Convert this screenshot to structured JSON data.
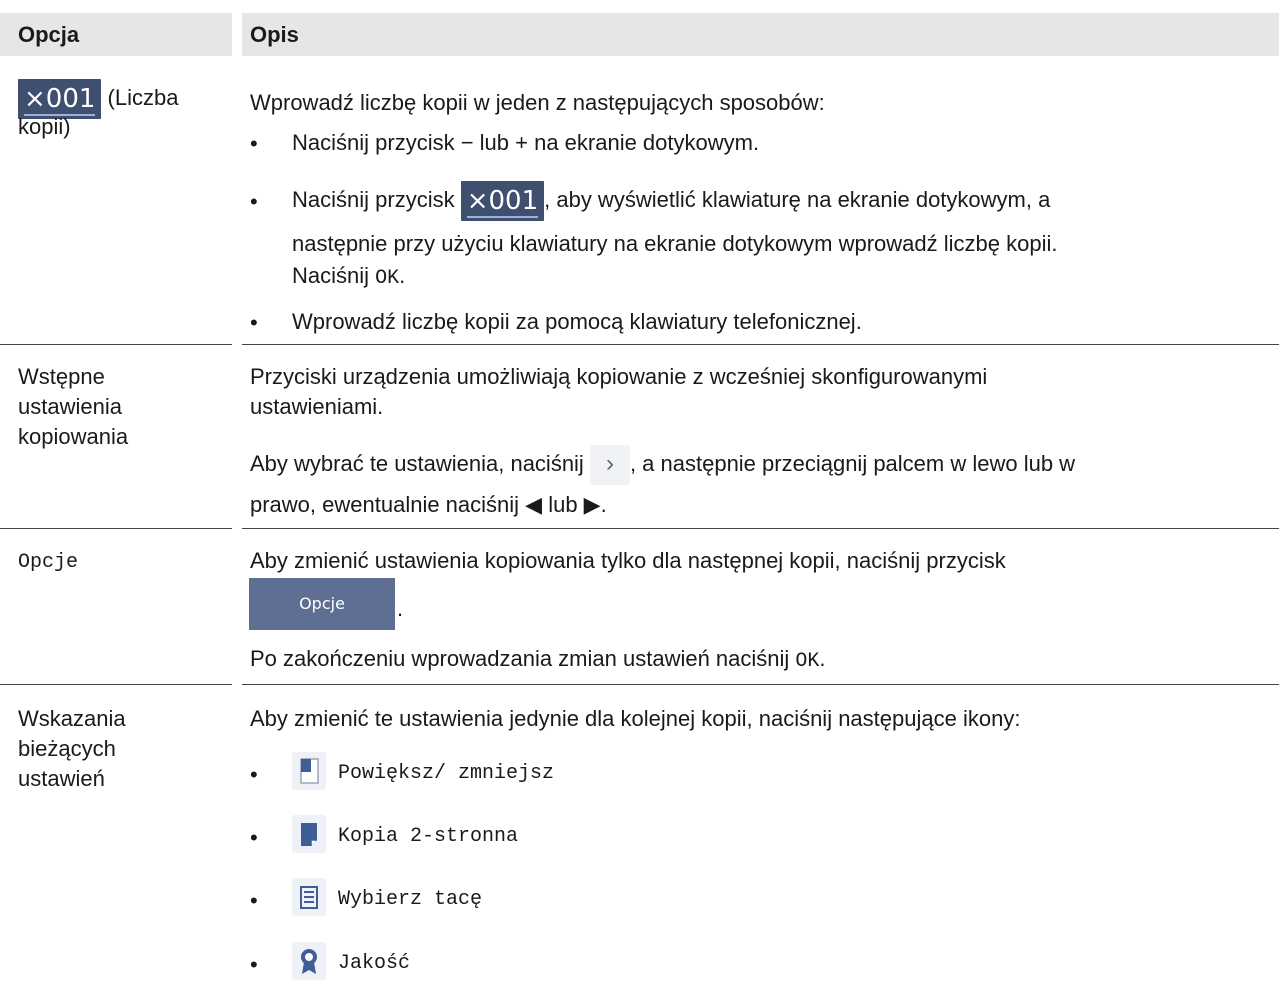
{
  "header": {
    "option": "Opcja",
    "description": "Opis"
  },
  "row1": {
    "chip": "×001",
    "option_suffix": " (Liczba",
    "option_line2": "kopii)",
    "intro": "Wprowadź liczbę kopii w jeden z następujących sposobów:",
    "b1": "Naciśnij przycisk − lub + na ekranie dotykowym.",
    "b2_pre": "Naciśnij przycisk ",
    "b2_post": ", aby wyświetlić klawiaturę na ekranie dotykowym, a",
    "b2_line2": "następnie przy użyciu klawiatury na ekranie dotykowym wprowadź liczbę kopii.",
    "b2_line3_pre": "Naciśnij ",
    "ok": "OK",
    "b2_line3_post": ".",
    "b3": "Wprowadź liczbę kopii za pomocą klawiatury telefonicznej."
  },
  "row2": {
    "option_lines": [
      "Wstępne",
      "ustawienia",
      "kopiowania"
    ],
    "p1_line1": "Przyciski urządzenia umożliwiają kopiowanie z wcześniej skonfigurowanymi",
    "p1_line2": "ustawieniami.",
    "p2_pre": "Aby wybrać te ustawienia, naciśnij ",
    "p2_post": ", a następnie przeciągnij palcem w lewo lub w",
    "p2_line2": "prawo, ewentualnie naciśnij ◀ lub ▶."
  },
  "row3": {
    "option": "Opcje",
    "p1": "Aby zmienić ustawienia kopiowania tylko dla następnej kopii, naciśnij przycisk",
    "button": "Opcje",
    "after_button": ".",
    "p2_pre": "Po zakończeniu wprowadzania zmian ustawień naciśnij ",
    "ok": "OK",
    "p2_post": "."
  },
  "row4": {
    "option_lines": [
      "Wskazania",
      "bieżących",
      "ustawień"
    ],
    "intro": "Aby zmienić te ustawienia jedynie dla kolejnej kopii, naciśnij następujące ikony:",
    "items": [
      {
        "icon": "enlarge-reduce-icon",
        "label": "Powiększ/ zmniejsz"
      },
      {
        "icon": "two-sided-copy-icon",
        "label": "Kopia 2-stronna"
      },
      {
        "icon": "tray-select-icon",
        "label": "Wybierz tacę"
      },
      {
        "icon": "quality-icon",
        "label": "Jakość"
      }
    ]
  },
  "bullet": "•",
  "colors": {
    "header_bg": "#e6e6e6",
    "chip_bg": "#3f4f6f",
    "button_bg": "#5e6f93",
    "icon_accent": "#3f5d96"
  }
}
